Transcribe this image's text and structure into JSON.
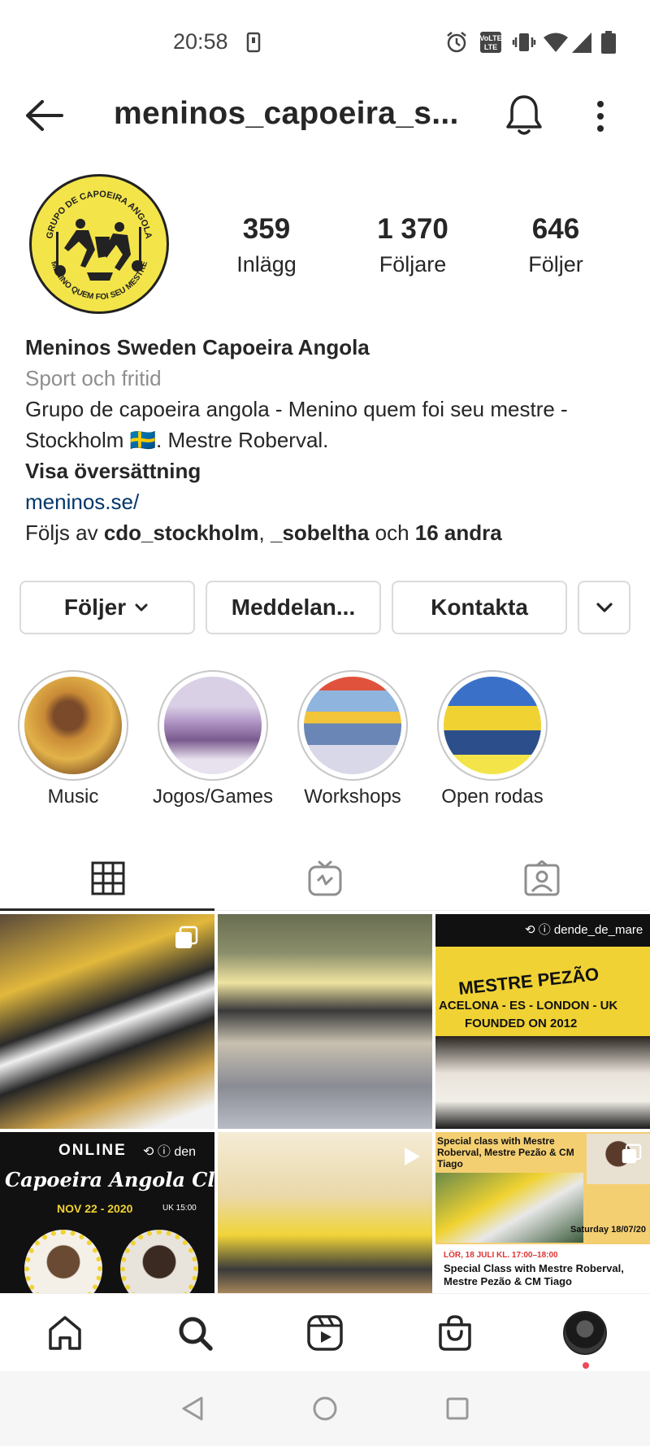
{
  "status_bar": {
    "time": "20:58",
    "icons": [
      "screenshot-icon",
      "alarm-icon",
      "volte-icon",
      "vibrate-icon",
      "wifi-icon",
      "signal-icon",
      "battery-icon"
    ],
    "volte_text": "VoLTE"
  },
  "header": {
    "username": "meninos_capoeira_s...",
    "icons": [
      "back-arrow-icon",
      "bell-icon",
      "more-vertical-icon"
    ]
  },
  "profile": {
    "avatar_text_top": "GRUPO DE CAPOEIRA ANGOLA",
    "avatar_text_bottom": "MENINO QUEM FOI SEU MESTRE",
    "stats": [
      {
        "value": "359",
        "label": "Inlägg"
      },
      {
        "value": "1 370",
        "label": "Följare"
      },
      {
        "value": "646",
        "label": "Följer"
      }
    ]
  },
  "bio": {
    "name": "Meninos Sweden Capoeira Angola",
    "category": "Sport och fritid",
    "text_line1": "Grupo de capoeira angola - Menino quem foi seu mestre -",
    "text_line2_a": "Stockholm",
    "flag": "🇸🇪",
    "text_line2_b": ". Mestre Roberval.",
    "translate": "Visa översättning",
    "link": "meninos.se/",
    "followed_prefix": "Följs av",
    "followed_user1": "cdo_stockholm",
    "followed_sep": ",",
    "followed_user2": "_sobeltha",
    "followed_and": "och",
    "followed_others": "16 andra"
  },
  "actions": {
    "following": "Följer",
    "message": "Meddelan...",
    "contact": "Kontakta"
  },
  "highlights": [
    {
      "label": "Music"
    },
    {
      "label": "Jogos/Games"
    },
    {
      "label": "Workshops"
    },
    {
      "label": "Open rodas"
    }
  ],
  "tabs": [
    "grid-icon",
    "igtv-icon",
    "tagged-icon"
  ],
  "posts": {
    "tile3_repost_user": "dende_de_mare",
    "tile3_banner": "MESTRE PEZÃO",
    "tile3_line1": "ACELONA - ES - LONDON - UK",
    "tile3_line2": "FOUNDED ON 2012",
    "tile4_online": "ONLINE",
    "tile4_repost_user": "den",
    "tile4_title": "Capoeira Angola Class",
    "tile4_date": "NOV 22 - 2020",
    "tile4_time": "UK 15:00",
    "tile6_header": "Special class with Mestre Roberval, Mestre Pezão & CM Tiago",
    "tile6_date": "Saturday 18/07/20",
    "tile6_event_time": "LÖR, 18 JULI KL. 17:00–18:00",
    "tile6_event_title": "Special Class with Mestre Roberval, Mestre Pezão & CM Tiago"
  },
  "bottom_nav": [
    "home-icon",
    "search-icon",
    "reels-icon",
    "shop-icon",
    "profile-avatar"
  ],
  "system_nav": [
    "back-triangle-icon",
    "home-circle-icon",
    "recents-square-icon"
  ],
  "colors": {
    "text": "#262626",
    "muted": "#8e8e8e",
    "link": "#00376b",
    "border": "#dbdbdb",
    "notification_dot": "#ed4956",
    "capoeira_yellow": "#f3e44a"
  }
}
